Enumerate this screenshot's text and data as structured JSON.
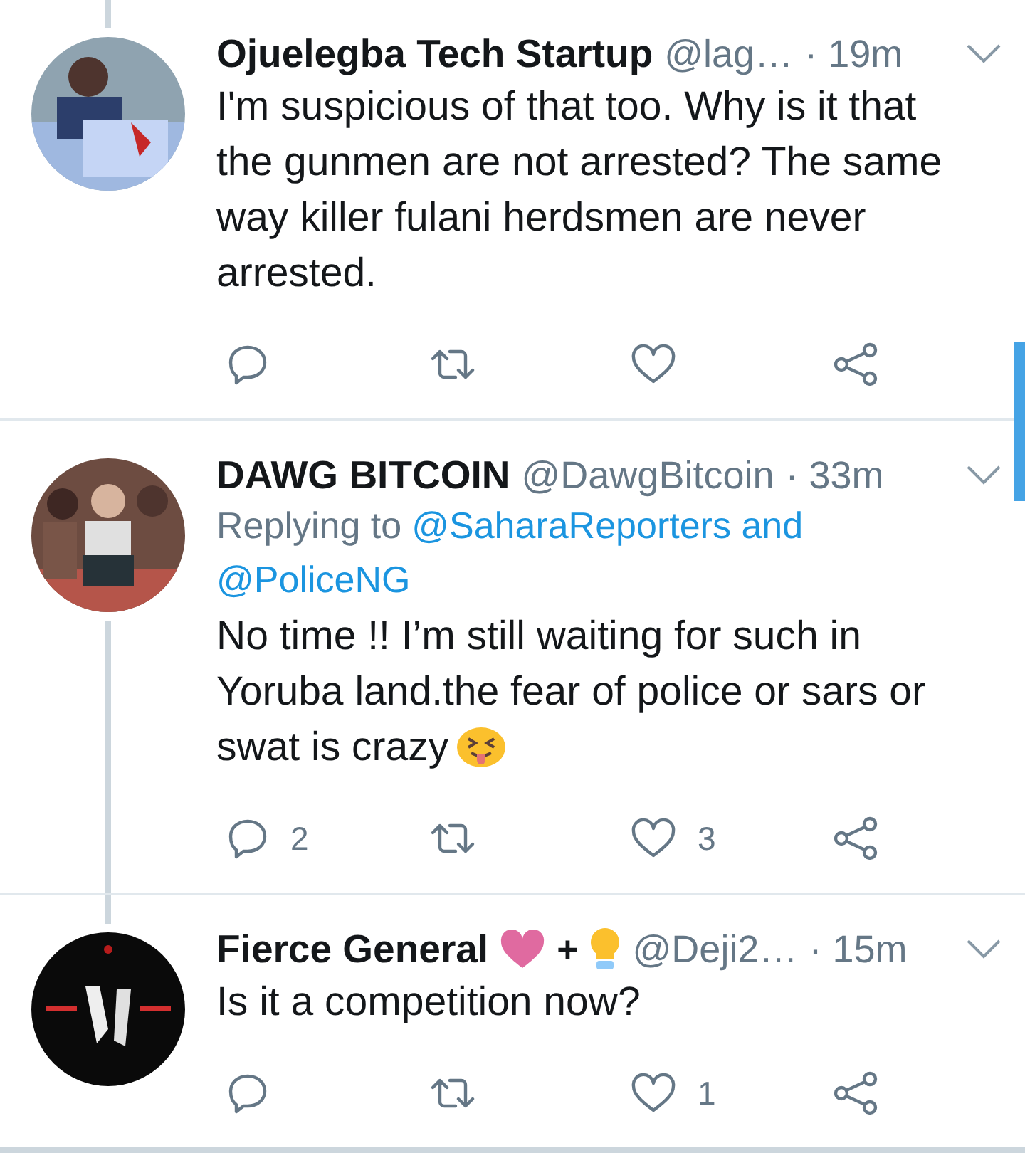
{
  "tweets": [
    {
      "name": "Ojuelegba Tech Startup",
      "handle": "@lag…",
      "time": "· 19m",
      "thread_above": true,
      "thread_below": false,
      "body": "I'm suspicious of that too. Why is it that the gunmen are not arrested? The same way killer fulani herdsmen are never arrested.",
      "actions": [
        {
          "kind": "reply"
        },
        {
          "kind": "retweet"
        },
        {
          "kind": "like"
        },
        {
          "kind": "share"
        }
      ]
    },
    {
      "name": "DAWG BITCOIN",
      "handle": "@DawgBitcoin",
      "time": "· 33m",
      "thread_above": false,
      "thread_below": true,
      "reply_to": {
        "prefix": "Replying to",
        "links": [
          "@SaharaReporters and",
          "@PoliceNG"
        ]
      },
      "body": "No time !! I’m still waiting for such in Yoruba land.the fear of police or sars or swat is crazy",
      "body_emoji": {
        "kind": "squint-tongue"
      },
      "actions": [
        {
          "kind": "reply",
          "count": "2"
        },
        {
          "kind": "retweet"
        },
        {
          "kind": "like",
          "count": "3"
        },
        {
          "kind": "share"
        }
      ]
    },
    {
      "name": "Fierce General",
      "name_extras": [
        {
          "kind": "heart"
        },
        {
          "kind": "text",
          "text": "+"
        },
        {
          "kind": "bulb"
        }
      ],
      "handle": "@Deji2…",
      "time": "· 15m",
      "thread_above": true,
      "thread_below": false,
      "body": "Is it a competition now?",
      "actions": [
        {
          "kind": "reply"
        },
        {
          "kind": "retweet"
        },
        {
          "kind": "like",
          "count": "1"
        },
        {
          "kind": "share"
        }
      ]
    }
  ]
}
